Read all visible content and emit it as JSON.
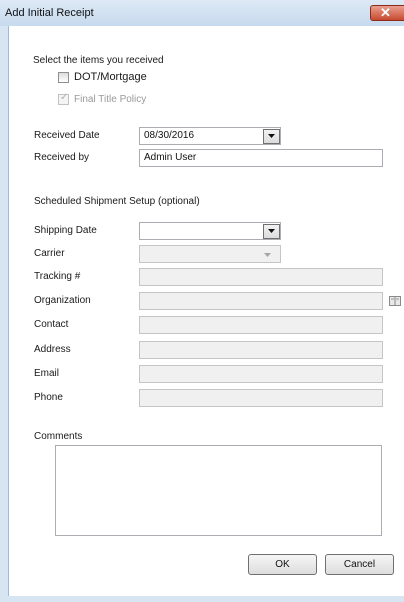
{
  "window": {
    "title": "Add Initial Receipt"
  },
  "items": {
    "heading": "Select the items you received",
    "dot_mortgage": {
      "label": "DOT/Mortgage",
      "checked": false
    },
    "final_title_policy": {
      "label": "Final Title Policy",
      "checked": true,
      "disabled": true
    }
  },
  "receipt": {
    "received_date_label": "Received Date",
    "received_date_value": "08/30/2016",
    "received_by_label": "Received by",
    "received_by_value": "Admin User"
  },
  "shipment": {
    "heading": "Scheduled Shipment Setup (optional)",
    "shipping_date_label": "Shipping Date",
    "shipping_date_value": "",
    "carrier_label": "Carrier",
    "carrier_value": "",
    "tracking_label": "Tracking #",
    "tracking_value": "",
    "organization_label": "Organization",
    "organization_value": "",
    "contact_label": "Contact",
    "contact_value": "",
    "address_label": "Address",
    "address_value": "",
    "email_label": "Email",
    "email_value": "",
    "phone_label": "Phone",
    "phone_value": ""
  },
  "comments": {
    "label": "Comments",
    "value": ""
  },
  "buttons": {
    "ok": "OK",
    "cancel": "Cancel"
  },
  "icons": {
    "close": "close-icon",
    "dropdown": "chevron-down-icon",
    "address_book": "address-book-icon"
  },
  "colors": {
    "title_bar": "#c8daee",
    "close_button": "#c84a30",
    "window_background": "#ffffff"
  }
}
